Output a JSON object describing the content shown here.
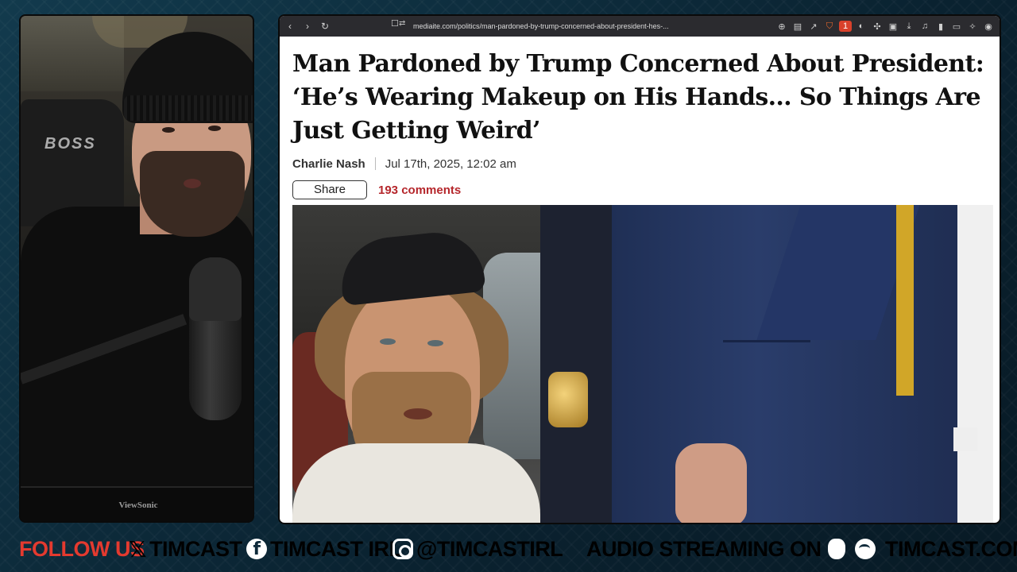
{
  "browser": {
    "url": "mediaite.com/politics/man-pardoned-by-trump-concerned-about-president-hes-...",
    "extension_badge": "1"
  },
  "article": {
    "headline": "Man Pardoned by Trump Concerned About President: ‘He’s Wearing Makeup on His Hands… So Things Are Just Getting Weird’",
    "author": "Charlie Nash",
    "date": "Jul 17th, 2025, 12:02 am",
    "share_label": "Share",
    "comments_label": "193 comments"
  },
  "webcam": {
    "chair_logo": "BOSS",
    "monitor_brand": "ViewSonic"
  },
  "ticker": {
    "follow": "FOLLOW US",
    "x_handle": "TIMCAST",
    "fb_handle": "TIMCAST IRL",
    "ig_handle": "@TIMCASTIRL",
    "audio": "AUDIO STREAMING ON",
    "site": "TIMCAST.COM"
  },
  "colors": {
    "accent_red": "#e43a2f",
    "comments_red": "#b5262b",
    "background": "#0d2a3a"
  }
}
